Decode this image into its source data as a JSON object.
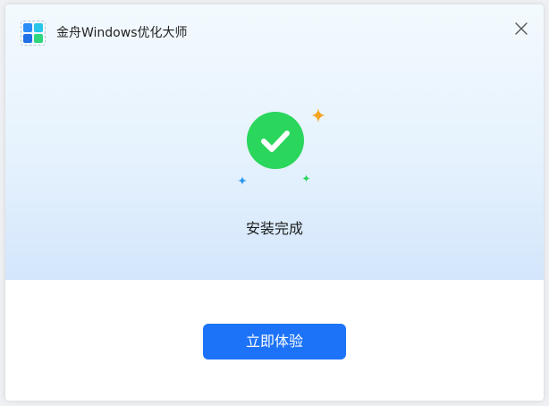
{
  "app": {
    "title": "金舟Windows优化大师"
  },
  "status": {
    "message": "安装完成"
  },
  "actions": {
    "primary_label": "立即体验"
  },
  "colors": {
    "accent": "#1d73f8",
    "success": "#2ad65c",
    "sparkle_orange": "#f3a51f",
    "sparkle_blue": "#2a97f0",
    "sparkle_green": "#2ad65c"
  },
  "icons": {
    "logo": "windows-logo-icon",
    "close": "close-icon",
    "status": "check-circle-icon"
  }
}
